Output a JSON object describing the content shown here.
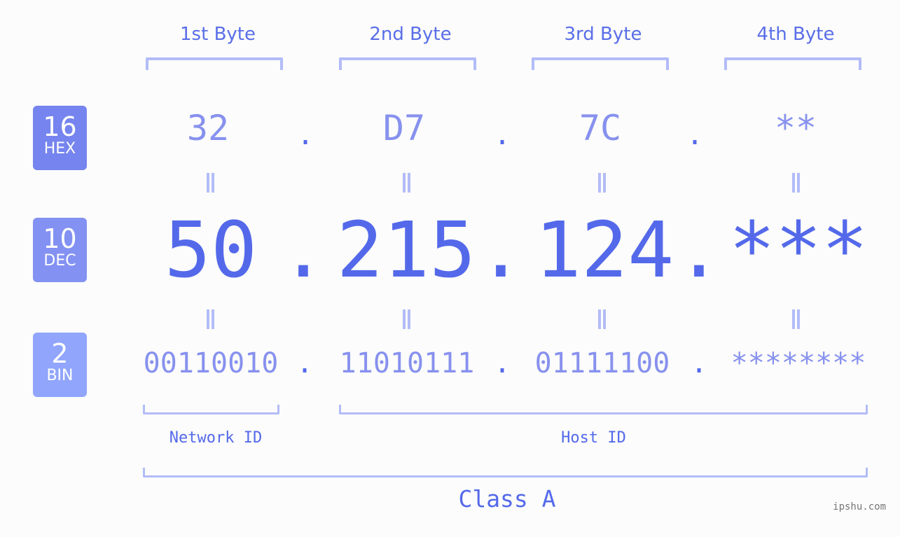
{
  "bytes": [
    {
      "label": "1st Byte",
      "hex": "32",
      "dec": "50",
      "bin": "00110010"
    },
    {
      "label": "2nd Byte",
      "hex": "D7",
      "dec": "215",
      "bin": "11010111"
    },
    {
      "label": "3rd Byte",
      "hex": "7C",
      "dec": "124",
      "bin": "01111100"
    },
    {
      "label": "4th Byte",
      "hex": "**",
      "dec": "***",
      "bin": "********"
    }
  ],
  "separator": ".",
  "bases": {
    "hex": {
      "num": "16",
      "label": "HEX",
      "color": "#7584ee"
    },
    "dec": {
      "num": "10",
      "label": "DEC",
      "color": "#8391f2"
    },
    "bin": {
      "num": "2",
      "label": "BIN",
      "color": "#90a5fb"
    }
  },
  "segments": {
    "network": "Network ID",
    "host": "Host ID"
  },
  "class_label": "Class A",
  "watermark": "ipshu.com"
}
